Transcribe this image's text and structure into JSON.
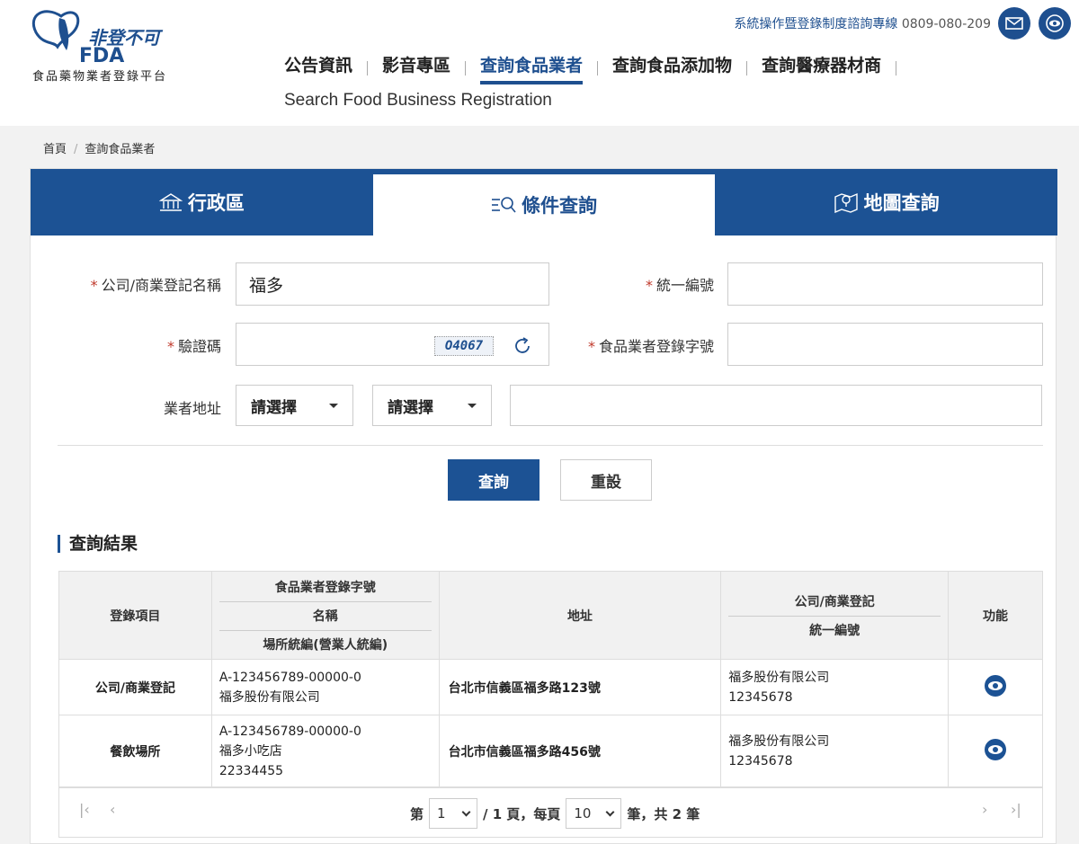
{
  "logo": {
    "brand": "非登不可",
    "fda": "FDA",
    "subtitle": "食品藥物業者登錄平台"
  },
  "header": {
    "hotline_label": "系統操作暨登錄制度諮詢專線",
    "hotline_number": "0809-080-209",
    "mail_icon": "mail-icon",
    "accessibility_icon": "eye-icon"
  },
  "nav": {
    "items": [
      "公告資訊",
      "影音專區",
      "查詢食品業者",
      "查詢食品添加物",
      "查詢醫療器材商"
    ],
    "active": "查詢食品業者"
  },
  "page_subtitle": "Search Food Business Registration",
  "breadcrumb": {
    "home": "首頁",
    "current": "查詢食品業者"
  },
  "tabs": [
    {
      "label": "行政區",
      "icon": "building-icon"
    },
    {
      "label": "條件查詢",
      "icon": "search-list-icon"
    },
    {
      "label": "地圖查詢",
      "icon": "map-pin-icon"
    }
  ],
  "form": {
    "company_name_label": "公司/商業登記名稱",
    "company_name_value": "福多",
    "tax_id_label": "統一編號",
    "tax_id_value": "",
    "captcha_label": "驗證碼",
    "captcha_value": "",
    "captcha_code": "O4067",
    "food_reg_label": "食品業者登錄字號",
    "food_reg_value": "",
    "address_label": "業者地址",
    "city_select": "請選擇",
    "district_select": "請選擇",
    "address_value": "",
    "search_button": "查詢",
    "reset_button": "重設"
  },
  "results": {
    "title": "查詢結果",
    "headers": {
      "col1": "登錄項目",
      "col2_a": "食品業者登錄字號",
      "col2_b": "名稱",
      "col2_c": "場所統編(營業人統編)",
      "col3": "地址",
      "col4_a": "公司/商業登記",
      "col4_b": "統一編號",
      "col5": "功能"
    },
    "rows": [
      {
        "type": "公司/商業登記",
        "reg_no": "A-123456789-00000-0",
        "name": "福多股份有限公司",
        "site_id": "",
        "address": "台北市信義區福多路123號",
        "company": "福多股份有限公司",
        "tax_id": "12345678"
      },
      {
        "type": "餐飲場所",
        "reg_no": "A-123456789-00000-0",
        "name": "福多小吃店",
        "site_id": "22334455",
        "address": "台北市信義區福多路456號",
        "company": "福多股份有限公司",
        "tax_id": "12345678"
      }
    ]
  },
  "pager": {
    "page_prefix": "第",
    "page_value": "1",
    "total_pages_text": "/ 1 頁，每頁",
    "per_page": "10",
    "total_text": "筆，共 2 筆"
  }
}
